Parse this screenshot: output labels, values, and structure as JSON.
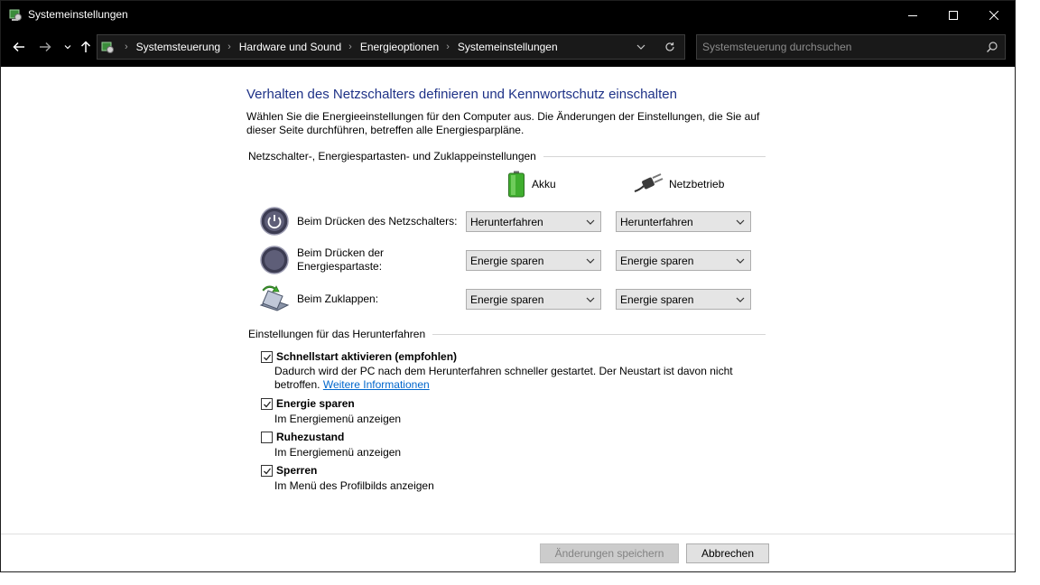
{
  "window": {
    "title": "Systemeinstellungen"
  },
  "nav": {
    "breadcrumbs": [
      "Systemsteuerung",
      "Hardware und Sound",
      "Energieoptionen",
      "Systemeinstellungen"
    ],
    "search_placeholder": "Systemsteuerung durchsuchen"
  },
  "page": {
    "title": "Verhalten des Netzschalters definieren und Kennwortschutz einschalten",
    "description": "Wählen Sie die Energieeinstellungen für den Computer aus. Die Änderungen der Einstellungen, die Sie auf dieser Seite durchführen, betreffen alle Energiesparpläne."
  },
  "power_buttons": {
    "section_title": "Netzschalter-, Energiespartasten- und Zuklappeinstellungen",
    "columns": {
      "battery": "Akku",
      "plugged_in": "Netzbetrieb"
    },
    "rows": [
      {
        "label": "Beim Drücken des Netzschalters:",
        "battery": "Herunterfahren",
        "plugged_in": "Herunterfahren",
        "icon": "power-button-icon"
      },
      {
        "label": "Beim Drücken der Energiespartaste:",
        "battery": "Energie sparen",
        "plugged_in": "Energie sparen",
        "icon": "sleep-button-icon"
      },
      {
        "label": "Beim Zuklappen:",
        "battery": "Energie sparen",
        "plugged_in": "Energie sparen",
        "icon": "laptop-lid-icon"
      }
    ]
  },
  "shutdown": {
    "section_title": "Einstellungen für das Herunterfahren",
    "items": [
      {
        "label": "Schnellstart aktivieren (empfohlen)",
        "checked": true,
        "description": "Dadurch wird der PC nach dem Herunterfahren schneller gestartet. Der Neustart ist davon nicht betroffen.",
        "link": "Weitere Informationen"
      },
      {
        "label": "Energie sparen",
        "checked": true,
        "description": "Im Energiemenü anzeigen"
      },
      {
        "label": "Ruhezustand",
        "checked": false,
        "description": "Im Energiemenü anzeigen"
      },
      {
        "label": "Sperren",
        "checked": true,
        "description": "Im Menü des Profilbilds anzeigen"
      }
    ]
  },
  "footer": {
    "save_label": "Änderungen speichern",
    "cancel_label": "Abbrechen"
  },
  "colors": {
    "title_blue": "#1e3287",
    "link_blue": "#0066cc",
    "titlebar_bg": "#000000"
  }
}
